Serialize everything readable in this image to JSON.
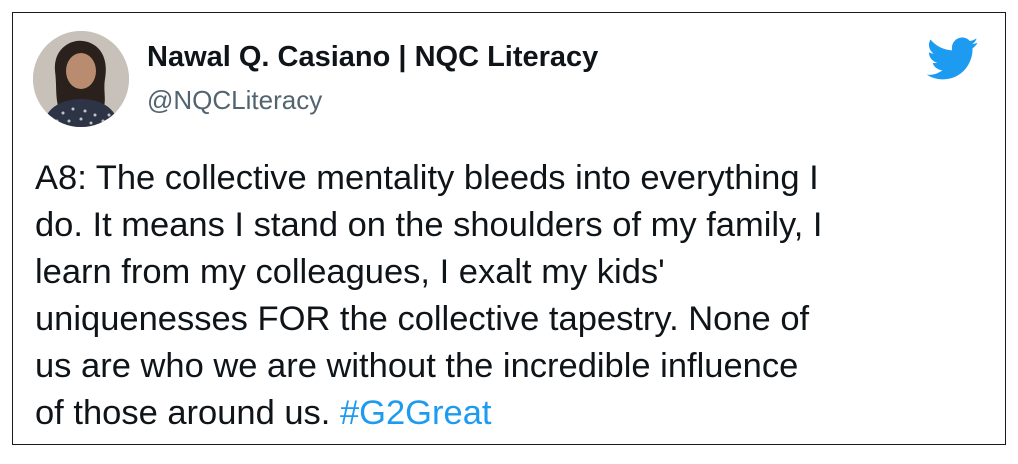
{
  "tweet": {
    "author": {
      "display_name": "Nawal Q. Casiano | NQC Literacy",
      "handle": "@NQCLiteracy"
    },
    "brand_icon": "twitter-bird-icon",
    "text_lines": [
      "A8: The collective mentality bleeds into everything I",
      "do. It means I stand on the shoulders of my family, I",
      "learn from my colleagues, I exalt my kids'",
      "uniquenesses FOR the collective tapestry. None of",
      "us are who we are without the incredible influence",
      "of those around us. "
    ],
    "hashtag": "#G2Great",
    "colors": {
      "text": "#0f1419",
      "handle": "#536471",
      "accent": "#1d9bf0"
    }
  }
}
